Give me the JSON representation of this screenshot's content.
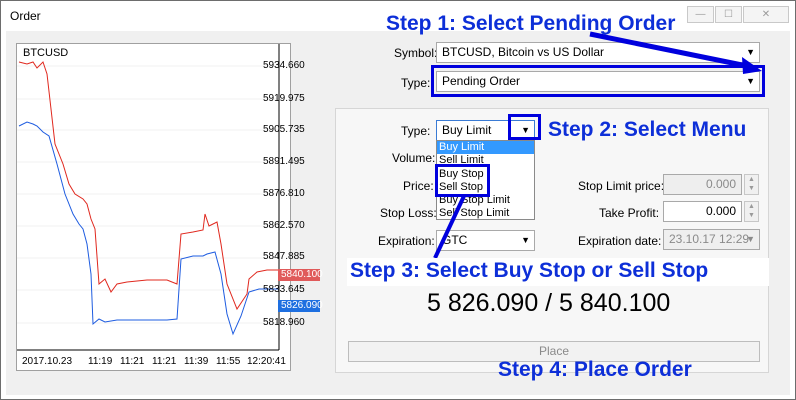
{
  "window": {
    "title": "Order"
  },
  "chart": {
    "symbol": "BTCUSD",
    "price_labels": [
      "5934.660",
      "5919.975",
      "5905.735",
      "5891.495",
      "5876.810",
      "5862.570",
      "5847.885",
      "5833.645",
      "5818.960"
    ],
    "ask_badge": "5840.100",
    "bid_badge": "5826.090",
    "time_labels": [
      "2017.10.23",
      "11:19",
      "11:21",
      "11:21",
      "11:39",
      "11:55",
      "12:20:41"
    ],
    "colors": {
      "ask_line": "#e0281e",
      "bid_line": "#1e5ce0",
      "ask_badge_bg": "#e05a5a",
      "bid_badge_bg": "#1e6fe0"
    }
  },
  "form": {
    "symbol_label": "Symbol:",
    "symbol_value": "BTCUSD, Bitcoin vs US Dollar",
    "type_label": "Type:",
    "type_value": "Pending Order",
    "inner_type_label": "Type:",
    "inner_type_value": "Buy Limit",
    "volume_label": "Volume:",
    "price_label": "Price:",
    "stop_loss_label": "Stop Loss:",
    "expiration_label": "Expiration:",
    "expiration_value": "GTC",
    "stop_limit_price_label": "Stop Limit price:",
    "stop_limit_price_value": "0.000",
    "take_profit_label": "Take Profit:",
    "take_profit_value": "0.000",
    "expiration_date_label": "Expiration date:",
    "expiration_date_value": "23.10.17 12:29",
    "type_options": [
      "Buy Limit",
      "Sell Limit",
      "Buy Stop",
      "Sell Stop",
      "Buy Stop Limit",
      "Sell Stop Limit"
    ],
    "quote": "5 826.090 / 5 840.100",
    "place_button": "Place"
  },
  "steps": {
    "step1": "Step 1: Select Pending Order",
    "step2": "Step 2: Select Menu",
    "step3": "Step 3: Select Buy Stop or Sell Stop",
    "step4": "Step 4: Place Order"
  },
  "annotation_color": "#0000dd"
}
